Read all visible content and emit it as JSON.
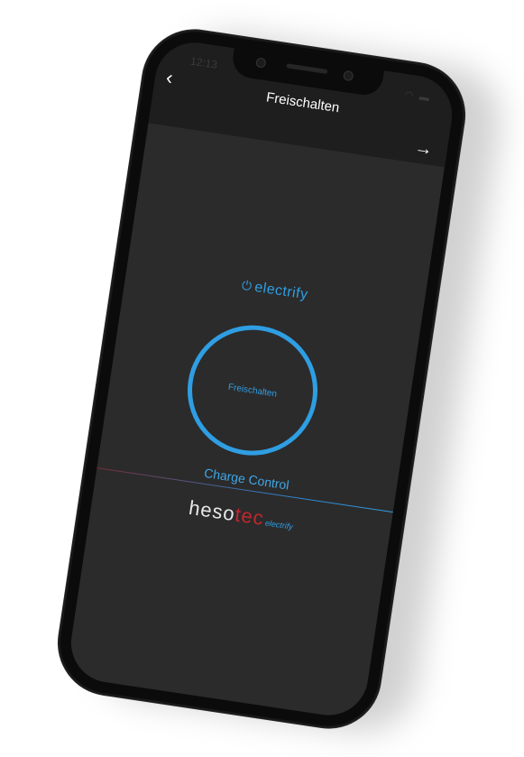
{
  "status_bar": {
    "time": "12:13",
    "icons": "wifi battery"
  },
  "navbar": {
    "back_icon": "chevron-left",
    "title": "Freischalten",
    "forward_icon": "arrow-right"
  },
  "brand": {
    "power_symbol": "⏻",
    "name": "electrify"
  },
  "unlock_button": {
    "label": "Freischalten"
  },
  "section": {
    "title": "Charge Control"
  },
  "maker_logo": {
    "part1": "heso",
    "part2": "tec",
    "sub": "electrify"
  },
  "colors": {
    "accent": "#2f9ee3",
    "screen_bg": "#2b2b2b",
    "navbar_bg": "#1e1e1e",
    "brand_red": "#c2272d"
  }
}
